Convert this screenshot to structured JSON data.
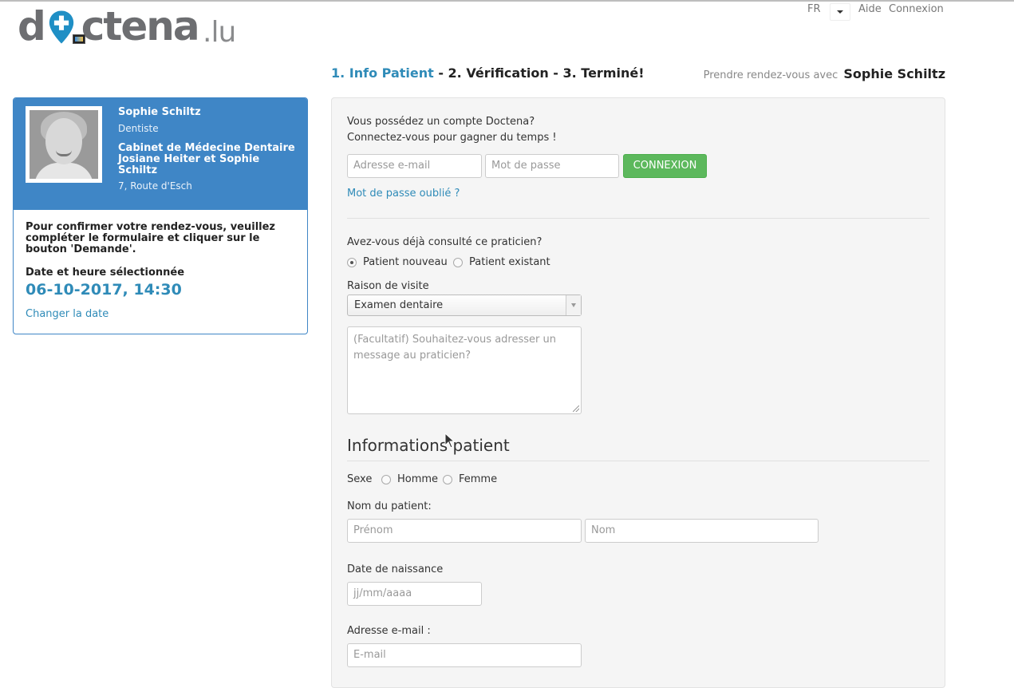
{
  "brand": {
    "logo_word": "doctena",
    "logo_tld": ".lu"
  },
  "topnav": {
    "language": "FR",
    "help": "Aide",
    "login": "Connexion"
  },
  "steps": {
    "step1": "1. Info Patient",
    "rest": " - 2. Vérification - 3. Terminé!"
  },
  "appointment_with": {
    "label": "Prendre rendez-vous avec",
    "doctor": "Sophie Schiltz"
  },
  "doctor_card": {
    "name": "Sophie Schiltz",
    "specialty": "Dentiste",
    "cabinet": "Cabinet de Médecine Dentaire Josiane Heiter et Sophie Schiltz",
    "address": "7, Route d'Esch",
    "confirm_text": "Pour confirmer votre rendez-vous, veuillez compléter le formulaire et cliquer sur le bouton 'Demande'.",
    "date_label": "Date et heure sélectionnée",
    "date_value": "06-10-2017, 14:30",
    "change_date": "Changer la date"
  },
  "account": {
    "question": "Vous possédez un compte Doctena?",
    "hint": "Connectez-vous pour gagner du temps !",
    "email_placeholder": "Adresse e-mail",
    "password_placeholder": "Mot de passe",
    "login_button": "CONNEXION",
    "forgot_password": "Mot de passe oublié ?"
  },
  "visit": {
    "consulted_question": "Avez-vous déjà consulté ce praticien?",
    "options": [
      "Patient nouveau",
      "Patient existant"
    ],
    "selected_option": "Patient nouveau",
    "reason_label": "Raison de visite",
    "reason_value": "Examen dentaire",
    "message_placeholder": "(Facultatif) Souhaitez-vous adresser un message au praticien?"
  },
  "patient_info": {
    "heading": "Informations patient",
    "sex_label": "Sexe",
    "sex_options": [
      "Homme",
      "Femme"
    ],
    "name_label": "Nom du patient:",
    "firstname_placeholder": "Prénom",
    "lastname_placeholder": "Nom",
    "birthdate_label": "Date de naissance",
    "birthdate_placeholder": "jj/mm/aaaa",
    "email_label": "Adresse e-mail :",
    "email_placeholder": "E-mail"
  },
  "colors": {
    "brand_blue": "#3f86c6",
    "link_blue": "#2f8bb8",
    "button_green": "#5cb85c"
  }
}
